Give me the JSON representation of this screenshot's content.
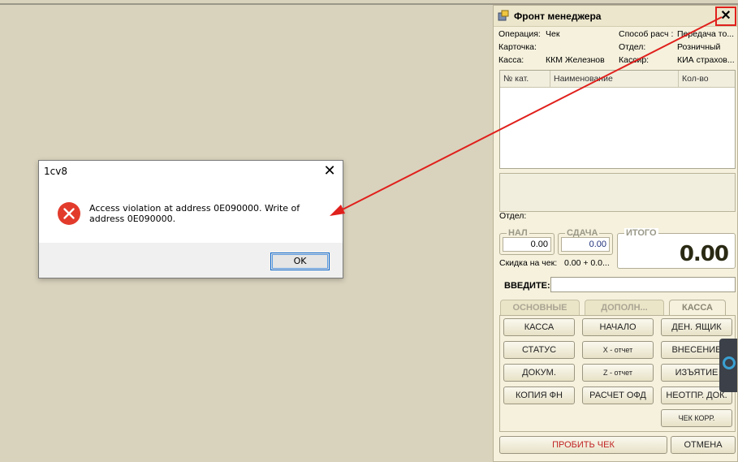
{
  "dialog": {
    "title": "1cv8",
    "close_glyph": "✕",
    "icon": "error-icon",
    "message": "Access violation at address 0E090000. Write of address 0E090000.",
    "ok_label": "OK"
  },
  "panel": {
    "title": "Фронт менеджера",
    "close_glyph": "✕",
    "info_left": [
      {
        "label": "Операция:",
        "value": "Чек"
      },
      {
        "label": "Карточка:",
        "value": ""
      },
      {
        "label": "Касса:",
        "value": "ККМ Железнов"
      }
    ],
    "info_right": [
      {
        "label": "Способ расч :",
        "value": "Передача то..."
      },
      {
        "label": "Отдел:",
        "value": "Розничный"
      },
      {
        "label": "Кассир:",
        "value": "КИА страхов..."
      }
    ],
    "grid_columns": [
      "№ кат.",
      "Наименование",
      "Кол-во"
    ],
    "department_label": "Отдел:",
    "cash_label": "НАЛ",
    "cash_value": "0.00",
    "change_label": "СДАЧА",
    "change_value": "0.00",
    "total_label": "ИТОГО",
    "total_value": "0.00",
    "discount_label": "Скидка на чек:",
    "discount_value": "0.00 + 0.0...",
    "enter_label": "ВВЕДИТЕ:",
    "tabs": [
      "ОСНОВНЫЕ",
      "ДОПОЛН...",
      "КАССА"
    ],
    "active_tab": "КАССА",
    "buttons": {
      "kassa": "КАССА",
      "nachalo": "НАЧАЛО",
      "den_yashik": "ДЕН. ЯЩИК",
      "status": "СТАТУС",
      "x_report": "X - отчет",
      "vnesenie": "ВНЕСЕНИЕ",
      "dokum": "ДОКУМ.",
      "z_report": "Z - отчет",
      "izyatie": "ИЗЪЯТИЕ",
      "kopiya_fn": "КОПИЯ ФН",
      "raschet_ofd": "РАСЧЕТ ОФД",
      "neotpr_dok": "НЕОТПР. ДОК.",
      "chek_korr": "ЧЕК КОРР.",
      "probit_chek": "ПРОБИТЬ ЧЕК",
      "otmena": "ОТМЕНА"
    }
  },
  "colors": {
    "desktop": "#d9d3bd",
    "panel_bg": "#f5f1dd",
    "highlight": "#e0201c",
    "error_red": "#e23b2c"
  }
}
